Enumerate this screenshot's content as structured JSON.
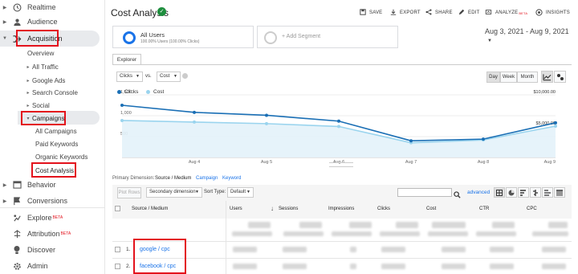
{
  "sidebar": {
    "items": [
      {
        "label": "Realtime"
      },
      {
        "label": "Audience"
      },
      {
        "label": "Acquisition"
      },
      {
        "label": "Overview"
      },
      {
        "label": "All Traffic"
      },
      {
        "label": "Google Ads"
      },
      {
        "label": "Search Console"
      },
      {
        "label": "Social"
      },
      {
        "label": "Campaigns"
      },
      {
        "label": "All Campaigns"
      },
      {
        "label": "Paid Keywords"
      },
      {
        "label": "Organic Keywords"
      },
      {
        "label": "Cost Analysis"
      },
      {
        "label": "Behavior"
      },
      {
        "label": "Conversions"
      },
      {
        "label": "Explore"
      },
      {
        "label": "Attribution"
      },
      {
        "label": "Discover"
      },
      {
        "label": "Admin"
      }
    ],
    "beta": "BETA"
  },
  "header": {
    "title": "Cost Analysis",
    "save": "SAVE",
    "export": "EXPORT",
    "share": "SHARE",
    "edit": "EDIT",
    "analyze": "ANALYZE",
    "insights": "INSIGHTS"
  },
  "segments": {
    "all_users": "All Users",
    "all_users_sub": "100.00% Users (100.00% Clicks)",
    "add": "+ Add Segment"
  },
  "date_range": "Aug 3, 2021 - Aug 9, 2021",
  "explorer_tab": "Explorer",
  "metric_select": {
    "first": "Clicks",
    "vs": "vs.",
    "second": "Cost"
  },
  "granularity": {
    "day": "Day",
    "week": "Week",
    "month": "Month"
  },
  "chart_data": {
    "type": "line",
    "x": [
      "Aug 3",
      "Aug 4",
      "Aug 5",
      "Aug 6",
      "Aug 7",
      "Aug 8",
      "Aug 9"
    ],
    "x_tick_labels": [
      "Aug 4",
      "Aug 5",
      "Aug 6",
      "Aug 7",
      "Aug 8",
      "Aug 9"
    ],
    "series": [
      {
        "name": "Clicks",
        "color": "#1a6fb5",
        "axis": "left",
        "values": [
          1250,
          1080,
          1010,
          870,
          400,
          440,
          830
        ]
      },
      {
        "name": "Cost",
        "color": "#9ad4ee",
        "axis": "right",
        "values": [
          5900,
          5650,
          5400,
          4950,
          2350,
          2800,
          5000
        ]
      }
    ],
    "left_ticks": [
      "1,500",
      "1,000",
      "500"
    ],
    "right_ticks": [
      "$10,000.00",
      "$5,000.00"
    ],
    "ylim_left": [
      0,
      1500
    ],
    "ylim_right": [
      0,
      10000
    ]
  },
  "primary_dimension": {
    "label": "Primary Dimension:",
    "active": "Source / Medium",
    "opt1": "Campaign",
    "opt2": "Keyword"
  },
  "controls": {
    "plot_rows": "Plot Rows",
    "secondary": "Secondary dimension",
    "sort_label": "Sort Type:",
    "sort_value": "Default",
    "advanced": "advanced"
  },
  "table": {
    "columns": [
      "Source / Medium",
      "Users",
      "Sessions",
      "Impressions",
      "Clicks",
      "Cost",
      "CTR",
      "CPC"
    ],
    "rows": [
      {
        "index": "1.",
        "source": "google / cpc"
      },
      {
        "index": "2.",
        "source": "facebook / cpc"
      }
    ]
  }
}
